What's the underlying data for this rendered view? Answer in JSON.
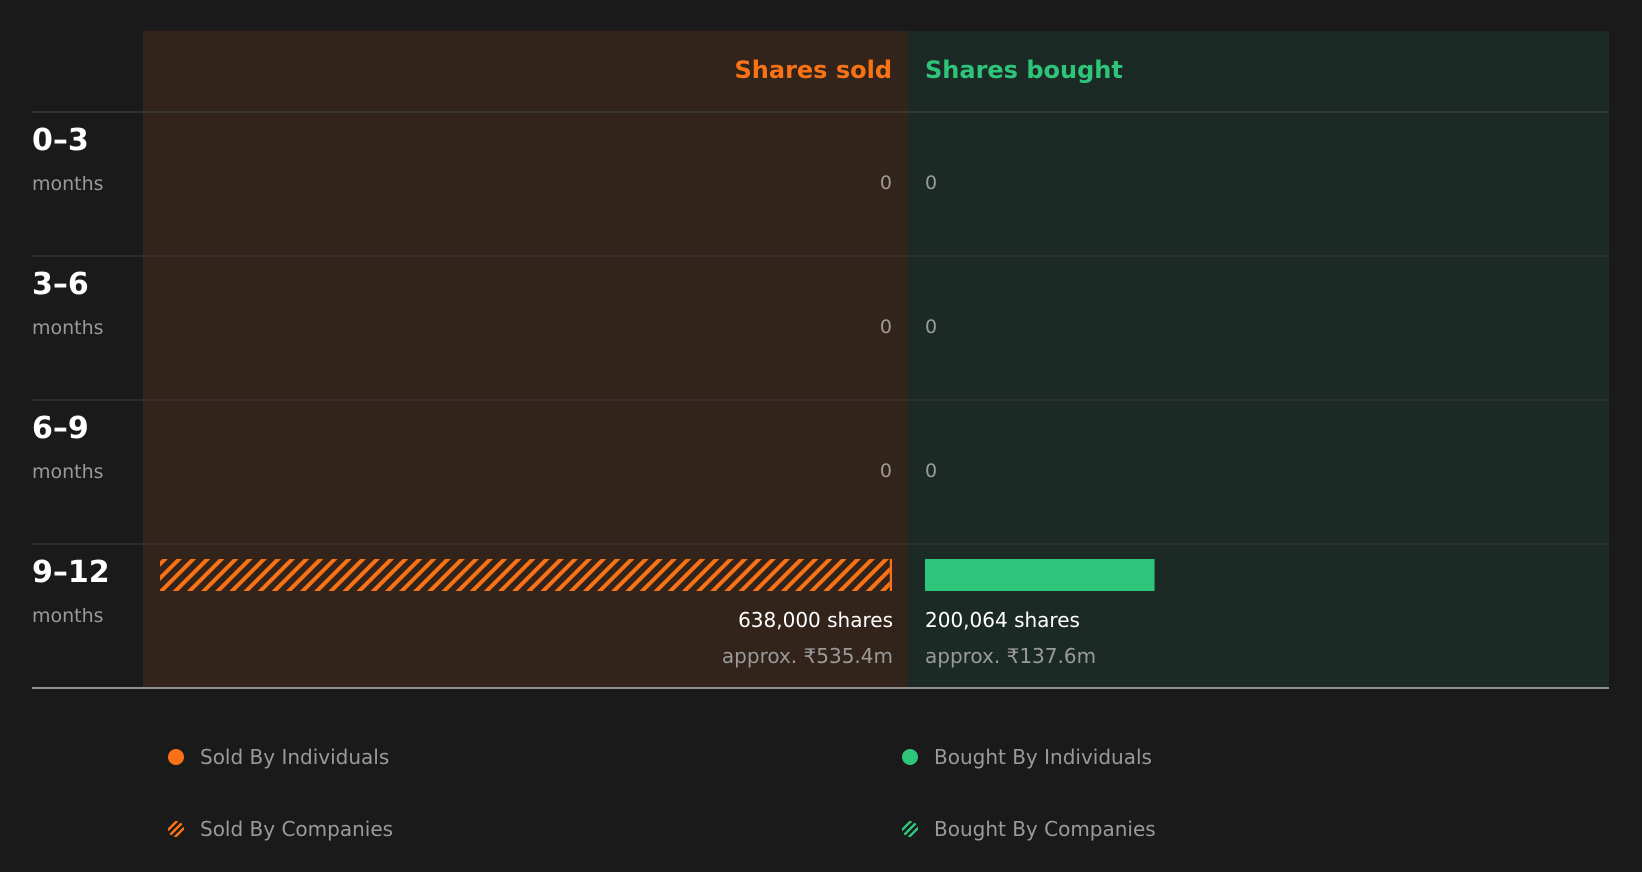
{
  "colors": {
    "sold": "#f97316",
    "bought": "#2ec47a",
    "sold_panel": "#32231b",
    "bought_panel": "#1c2a25",
    "background": "#1a1a1a"
  },
  "chart_data": {
    "type": "bar",
    "orientation": "horizontal-diverging",
    "headers": {
      "sold": "Shares sold",
      "bought": "Shares bought"
    },
    "categories": [
      {
        "range": "0–3",
        "unit": "months"
      },
      {
        "range": "3–6",
        "unit": "months"
      },
      {
        "range": "6–9",
        "unit": "months"
      },
      {
        "range": "9–12",
        "unit": "months"
      }
    ],
    "series": [
      {
        "name": "Sold By Individuals",
        "side": "sold",
        "pattern": "solid",
        "values": [
          0,
          0,
          0,
          2000
        ]
      },
      {
        "name": "Sold By Companies",
        "side": "sold",
        "pattern": "hatched",
        "values": [
          0,
          0,
          0,
          636000
        ]
      },
      {
        "name": "Bought By Individuals",
        "side": "bought",
        "pattern": "solid",
        "values": [
          0,
          0,
          0,
          200064
        ]
      },
      {
        "name": "Bought By Companies",
        "side": "bought",
        "pattern": "hatched",
        "values": [
          0,
          0,
          0,
          0
        ]
      }
    ],
    "sold_totals": [
      {
        "label": "0",
        "shares": "",
        "approx": ""
      },
      {
        "label": "0",
        "shares": "",
        "approx": ""
      },
      {
        "label": "0",
        "shares": "",
        "approx": ""
      },
      {
        "label": "",
        "shares": "638,000 shares",
        "approx": "approx. ₹535.4m"
      }
    ],
    "bought_totals": [
      {
        "label": "0",
        "shares": "",
        "approx": ""
      },
      {
        "label": "0",
        "shares": "",
        "approx": ""
      },
      {
        "label": "0",
        "shares": "",
        "approx": ""
      },
      {
        "label": "",
        "shares": "200,064 shares",
        "approx": "approx. ₹137.6m"
      }
    ],
    "max_value": 638000,
    "legend_position": "bottom"
  },
  "legend": [
    {
      "label": "Sold By Individuals",
      "icon": "solid-orange-dot"
    },
    {
      "label": "Bought By Individuals",
      "icon": "solid-green-dot"
    },
    {
      "label": "Sold By Companies",
      "icon": "hatched-orange-dot"
    },
    {
      "label": "Bought By Companies",
      "icon": "hatched-green-dot"
    }
  ]
}
